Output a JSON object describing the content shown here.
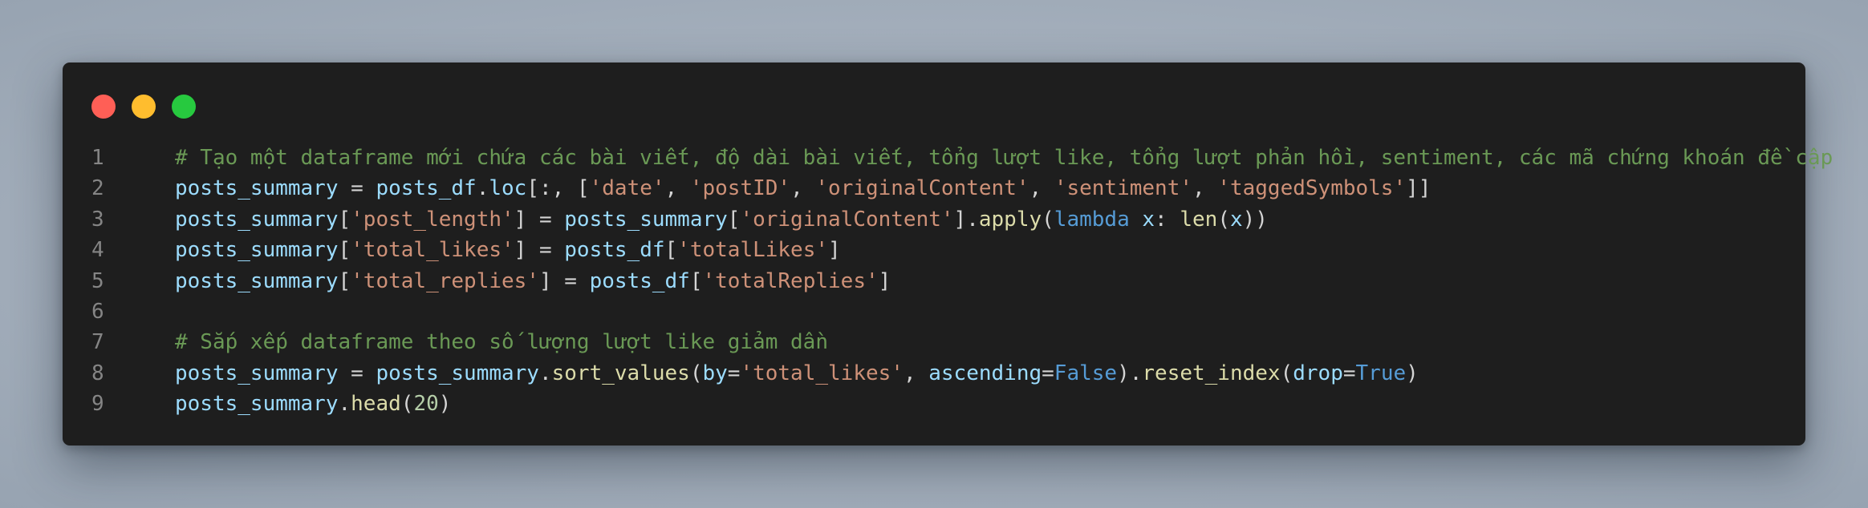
{
  "window": {
    "controls": [
      {
        "name": "close",
        "color": "#ff5f56"
      },
      {
        "name": "minimize",
        "color": "#ffbd2e"
      },
      {
        "name": "maximize",
        "color": "#27c93f"
      }
    ]
  },
  "colors": {
    "background": "#1e1e1e",
    "comment": "#6a9955",
    "variable": "#9cdcfe",
    "string": "#ce9178",
    "function": "#dcdcaa",
    "keyword": "#569cd6",
    "number": "#b5cea8",
    "line_number": "#858585"
  },
  "lines": [
    {
      "number": "1",
      "tokens": [
        {
          "t": "comment",
          "v": "# Tạo một dataframe mới chứa các bài viết, độ dài bài viết, tổng lượt like, tổng lượt phản hồi, sentiment, các mã chứng khoán đề cập"
        }
      ]
    },
    {
      "number": "2",
      "tokens": [
        {
          "t": "var",
          "v": "posts_summary"
        },
        {
          "t": "op",
          "v": " = "
        },
        {
          "t": "var",
          "v": "posts_df"
        },
        {
          "t": "op",
          "v": "."
        },
        {
          "t": "var",
          "v": "loc"
        },
        {
          "t": "op",
          "v": "[:, ["
        },
        {
          "t": "str",
          "v": "'date'"
        },
        {
          "t": "op",
          "v": ", "
        },
        {
          "t": "str",
          "v": "'postID'"
        },
        {
          "t": "op",
          "v": ", "
        },
        {
          "t": "str",
          "v": "'originalContent'"
        },
        {
          "t": "op",
          "v": ", "
        },
        {
          "t": "str",
          "v": "'sentiment'"
        },
        {
          "t": "op",
          "v": ", "
        },
        {
          "t": "str",
          "v": "'taggedSymbols'"
        },
        {
          "t": "op",
          "v": "]]"
        }
      ]
    },
    {
      "number": "3",
      "tokens": [
        {
          "t": "var",
          "v": "posts_summary"
        },
        {
          "t": "op",
          "v": "["
        },
        {
          "t": "str",
          "v": "'post_length'"
        },
        {
          "t": "op",
          "v": "] = "
        },
        {
          "t": "var",
          "v": "posts_summary"
        },
        {
          "t": "op",
          "v": "["
        },
        {
          "t": "str",
          "v": "'originalContent'"
        },
        {
          "t": "op",
          "v": "]."
        },
        {
          "t": "fn",
          "v": "apply"
        },
        {
          "t": "op",
          "v": "("
        },
        {
          "t": "kw",
          "v": "lambda"
        },
        {
          "t": "op",
          "v": " "
        },
        {
          "t": "var",
          "v": "x"
        },
        {
          "t": "op",
          "v": ": "
        },
        {
          "t": "fn",
          "v": "len"
        },
        {
          "t": "op",
          "v": "("
        },
        {
          "t": "var",
          "v": "x"
        },
        {
          "t": "op",
          "v": "))"
        }
      ]
    },
    {
      "number": "4",
      "tokens": [
        {
          "t": "var",
          "v": "posts_summary"
        },
        {
          "t": "op",
          "v": "["
        },
        {
          "t": "str",
          "v": "'total_likes'"
        },
        {
          "t": "op",
          "v": "] = "
        },
        {
          "t": "var",
          "v": "posts_df"
        },
        {
          "t": "op",
          "v": "["
        },
        {
          "t": "str",
          "v": "'totalLikes'"
        },
        {
          "t": "op",
          "v": "]"
        }
      ]
    },
    {
      "number": "5",
      "tokens": [
        {
          "t": "var",
          "v": "posts_summary"
        },
        {
          "t": "op",
          "v": "["
        },
        {
          "t": "str",
          "v": "'total_replies'"
        },
        {
          "t": "op",
          "v": "] = "
        },
        {
          "t": "var",
          "v": "posts_df"
        },
        {
          "t": "op",
          "v": "["
        },
        {
          "t": "str",
          "v": "'totalReplies'"
        },
        {
          "t": "op",
          "v": "]"
        }
      ]
    },
    {
      "number": "6",
      "tokens": []
    },
    {
      "number": "7",
      "tokens": [
        {
          "t": "comment",
          "v": "# Sắp xếp dataframe theo số lượng lượt like giảm dần"
        }
      ]
    },
    {
      "number": "8",
      "tokens": [
        {
          "t": "var",
          "v": "posts_summary"
        },
        {
          "t": "op",
          "v": " = "
        },
        {
          "t": "var",
          "v": "posts_summary"
        },
        {
          "t": "op",
          "v": "."
        },
        {
          "t": "fn",
          "v": "sort_values"
        },
        {
          "t": "op",
          "v": "("
        },
        {
          "t": "var",
          "v": "by"
        },
        {
          "t": "op",
          "v": "="
        },
        {
          "t": "str",
          "v": "'total_likes'"
        },
        {
          "t": "op",
          "v": ", "
        },
        {
          "t": "var",
          "v": "ascending"
        },
        {
          "t": "op",
          "v": "="
        },
        {
          "t": "kw",
          "v": "False"
        },
        {
          "t": "op",
          "v": ")."
        },
        {
          "t": "fn",
          "v": "reset_index"
        },
        {
          "t": "op",
          "v": "("
        },
        {
          "t": "var",
          "v": "drop"
        },
        {
          "t": "op",
          "v": "="
        },
        {
          "t": "kw",
          "v": "True"
        },
        {
          "t": "op",
          "v": ")"
        }
      ]
    },
    {
      "number": "9",
      "tokens": [
        {
          "t": "var",
          "v": "posts_summary"
        },
        {
          "t": "op",
          "v": "."
        },
        {
          "t": "fn",
          "v": "head"
        },
        {
          "t": "op",
          "v": "("
        },
        {
          "t": "num",
          "v": "20"
        },
        {
          "t": "op",
          "v": ")"
        }
      ]
    }
  ]
}
